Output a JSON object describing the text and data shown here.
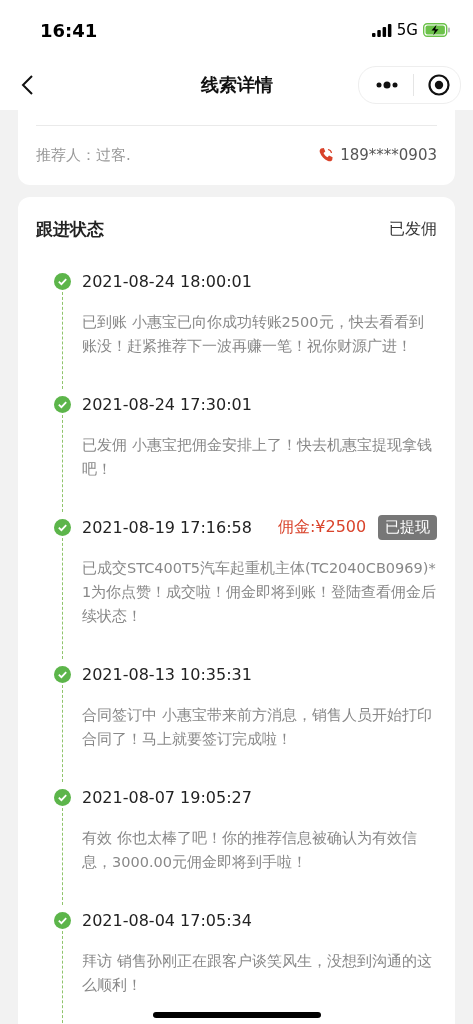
{
  "status_bar": {
    "time": "16:41",
    "network": "5G"
  },
  "nav": {
    "title": "线索详情"
  },
  "referrer": {
    "label": "推荐人：过客.",
    "phone": "189****0903"
  },
  "follow": {
    "title": "跟进状态",
    "status": "已发佣",
    "events": [
      {
        "time": "2021-08-24 18:00:01",
        "text": "已到账 小惠宝已向你成功转账2500元，快去看看到账没！赶紧推荐下一波再赚一笔！祝你财源广进！"
      },
      {
        "time": "2021-08-24 17:30:01",
        "text": "已发佣 小惠宝把佣金安排上了！快去机惠宝提现拿钱吧！"
      },
      {
        "time": "2021-08-19 17:16:58",
        "commission": "佣金:¥2500",
        "badge": "已提现",
        "text": "已成交STC400T5汽车起重机主体(TC2040CB0969)*1为你点赞！成交啦！佣金即将到账！登陆查看佣金后续状态！"
      },
      {
        "time": "2021-08-13 10:35:31",
        "text": "合同签订中 小惠宝带来前方消息，销售人员开始打印合同了！马上就要签订完成啦！"
      },
      {
        "time": "2021-08-07 19:05:27",
        "text": "有效 你也太棒了吧！你的推荐信息被确认为有效信息，3000.00元佣金即将到手啦！"
      },
      {
        "time": "2021-08-04 17:05:34",
        "text": "拜访 销售孙刚正在跟客户谈笑风生，没想到沟通的这么顺利！"
      }
    ]
  }
}
